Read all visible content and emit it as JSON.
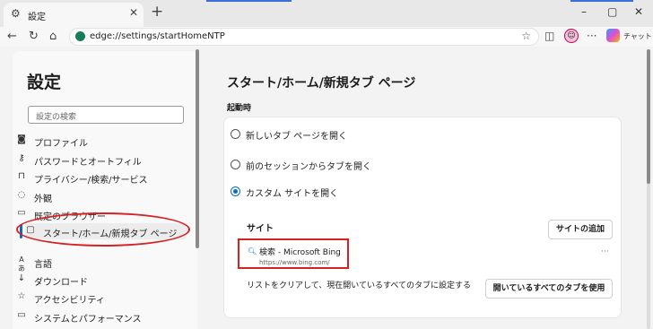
{
  "tab": {
    "title": "設定",
    "close": "✕",
    "new_tab": "+",
    "icon": "gear-icon"
  },
  "window": {
    "minimize": "–",
    "maximize": "▢",
    "close": "✕"
  },
  "toolbar": {
    "back": "←",
    "refresh": "↻",
    "home": "⌂",
    "url": "edge://settings/startHomeNTP",
    "favorite": "☆",
    "split": "◫",
    "more": "···",
    "chat_label": "チャット"
  },
  "sidebar": {
    "title": "設定",
    "search_placeholder": "設定の検索",
    "items": [
      {
        "icon": "profile-icon",
        "glyph": "◙",
        "label": "プロファイル"
      },
      {
        "icon": "key-icon",
        "glyph": "⚷",
        "label": "パスワードとオートフィル"
      },
      {
        "icon": "lock-icon",
        "glyph": "⊓",
        "label": "プライバシー/検索/サービス"
      },
      {
        "icon": "appearance-icon",
        "glyph": "◌",
        "label": "外観"
      },
      {
        "icon": "browser-icon",
        "glyph": "▭",
        "label": "既定のブラウザー"
      },
      {
        "icon": "start-page-icon",
        "glyph": "▢",
        "label": "スタート/ホーム/新規タブ ページ"
      },
      {
        "icon": "language-icon",
        "glyph": "Aあ",
        "label": "言語"
      },
      {
        "icon": "download-icon",
        "glyph": "↓",
        "label": "ダウンロード"
      },
      {
        "icon": "accessibility-icon",
        "glyph": "☆",
        "label": "アクセシビリティ"
      },
      {
        "icon": "system-icon",
        "glyph": "▭",
        "label": "システムとパフォーマンス"
      }
    ]
  },
  "main": {
    "title": "スタート/ホーム/新規タブ ページ",
    "startup_label": "起動時",
    "options": [
      {
        "label": "新しいタブ ページを開く",
        "selected": false
      },
      {
        "label": "前のセッションからタブを開く",
        "selected": false
      },
      {
        "label": "カスタム サイトを開く",
        "selected": true
      }
    ],
    "sites_heading": "サイト",
    "add_site_button": "サイトの追加",
    "site": {
      "name": "検索 - Microsoft Bing",
      "url": "https://www.bing.com/",
      "more": "···"
    },
    "clear_text": "リストをクリアして、現在開いているすべてのタブに設定する",
    "use_all_tabs_button": "開いているすべてのタブを使用"
  }
}
